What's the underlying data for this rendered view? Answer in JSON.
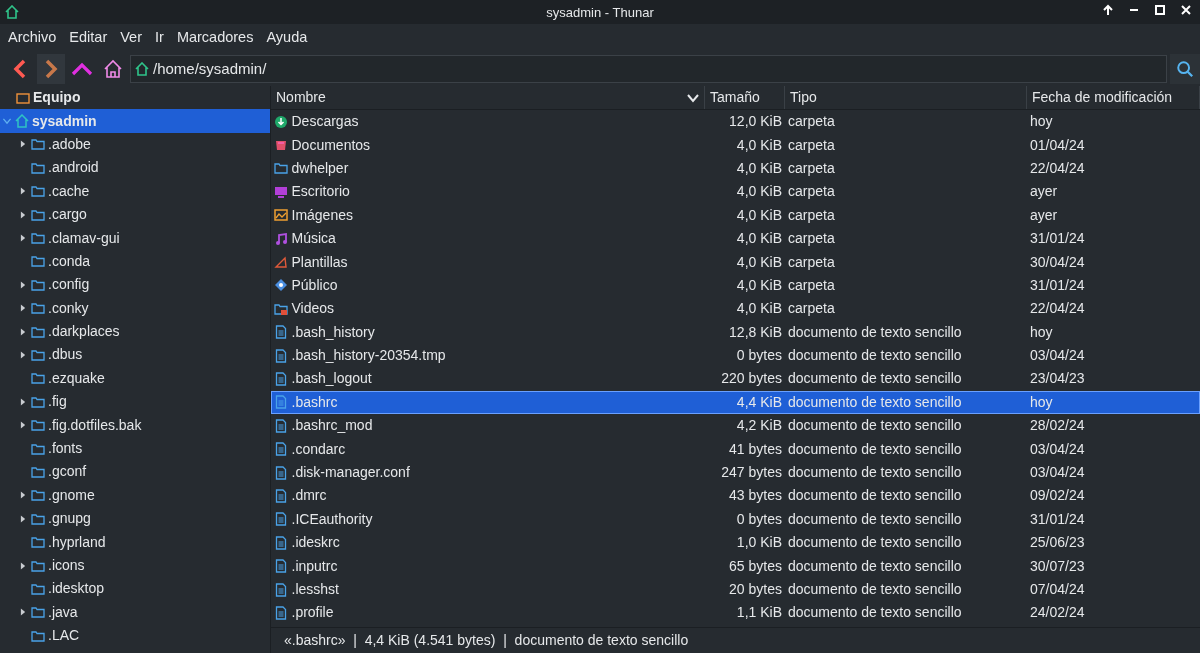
{
  "window": {
    "title": "sysadmin - Thunar"
  },
  "menu": [
    "Archivo",
    "Editar",
    "Ver",
    "Ir",
    "Marcadores",
    "Ayuda"
  ],
  "location": {
    "path": "/home/sysadmin/"
  },
  "sidebar": {
    "header": "Equipo",
    "tree": [
      {
        "label": "sysadmin",
        "selected": true,
        "expanded": true,
        "children": [
          {
            "label": ".adobe",
            "expandable": true
          },
          {
            "label": ".android",
            "expandable": false
          },
          {
            "label": ".cache",
            "expandable": true
          },
          {
            "label": ".cargo",
            "expandable": true
          },
          {
            "label": ".clamav-gui",
            "expandable": true
          },
          {
            "label": ".conda",
            "expandable": false
          },
          {
            "label": ".config",
            "expandable": true
          },
          {
            "label": ".conky",
            "expandable": true
          },
          {
            "label": ".darkplaces",
            "expandable": true
          },
          {
            "label": ".dbus",
            "expandable": true
          },
          {
            "label": ".ezquake",
            "expandable": false
          },
          {
            "label": ".fig",
            "expandable": true
          },
          {
            "label": ".fig.dotfiles.bak",
            "expandable": true
          },
          {
            "label": ".fonts",
            "expandable": false
          },
          {
            "label": ".gconf",
            "expandable": false
          },
          {
            "label": ".gnome",
            "expandable": true
          },
          {
            "label": ".gnupg",
            "expandable": true
          },
          {
            "label": ".hyprland",
            "expandable": false
          },
          {
            "label": ".icons",
            "expandable": true
          },
          {
            "label": ".idesktop",
            "expandable": false
          },
          {
            "label": ".java",
            "expandable": true
          },
          {
            "label": ".LAC",
            "expandable": false
          }
        ]
      }
    ]
  },
  "table": {
    "columns": [
      "Nombre",
      "Tamaño",
      "Tipo",
      "Fecha de modificación"
    ],
    "rows": [
      {
        "kind": "downloads",
        "name": "Descargas",
        "size": "12,0 KiB",
        "type": "carpeta",
        "date": "hoy",
        "selected": false
      },
      {
        "kind": "documents",
        "name": "Documentos",
        "size": "4,0 KiB",
        "type": "carpeta",
        "date": "01/04/24",
        "selected": false
      },
      {
        "kind": "folder",
        "name": "dwhelper",
        "size": "4,0 KiB",
        "type": "carpeta",
        "date": "22/04/24",
        "selected": false
      },
      {
        "kind": "desktop",
        "name": "Escritorio",
        "size": "4,0 KiB",
        "type": "carpeta",
        "date": "ayer",
        "selected": false
      },
      {
        "kind": "pictures",
        "name": "Imágenes",
        "size": "4,0 KiB",
        "type": "carpeta",
        "date": "ayer",
        "selected": false
      },
      {
        "kind": "music",
        "name": "Música",
        "size": "4,0 KiB",
        "type": "carpeta",
        "date": "31/01/24",
        "selected": false
      },
      {
        "kind": "templates",
        "name": "Plantillas",
        "size": "4,0 KiB",
        "type": "carpeta",
        "date": "30/04/24",
        "selected": false
      },
      {
        "kind": "public",
        "name": "Público",
        "size": "4,0 KiB",
        "type": "carpeta",
        "date": "31/01/24",
        "selected": false
      },
      {
        "kind": "videos",
        "name": "Videos",
        "size": "4,0 KiB",
        "type": "carpeta",
        "date": "22/04/24",
        "selected": false
      },
      {
        "kind": "text",
        "name": ".bash_history",
        "size": "12,8 KiB",
        "type": "documento de texto sencillo",
        "date": "hoy",
        "selected": false
      },
      {
        "kind": "text",
        "name": ".bash_history-20354.tmp",
        "size": "0 bytes",
        "type": "documento de texto sencillo",
        "date": "03/04/24",
        "selected": false
      },
      {
        "kind": "text",
        "name": ".bash_logout",
        "size": "220 bytes",
        "type": "documento de texto sencillo",
        "date": "23/04/23",
        "selected": false
      },
      {
        "kind": "text",
        "name": ".bashrc",
        "size": "4,4 KiB",
        "type": "documento de texto sencillo",
        "date": "hoy",
        "selected": true
      },
      {
        "kind": "text",
        "name": ".bashrc_mod",
        "size": "4,2 KiB",
        "type": "documento de texto sencillo",
        "date": "28/02/24",
        "selected": false
      },
      {
        "kind": "text",
        "name": ".condarc",
        "size": "41 bytes",
        "type": "documento de texto sencillo",
        "date": "03/04/24",
        "selected": false
      },
      {
        "kind": "text",
        "name": ".disk-manager.conf",
        "size": "247 bytes",
        "type": "documento de texto sencillo",
        "date": "03/04/24",
        "selected": false
      },
      {
        "kind": "text",
        "name": ".dmrc",
        "size": "43 bytes",
        "type": "documento de texto sencillo",
        "date": "09/02/24",
        "selected": false
      },
      {
        "kind": "text",
        "name": ".ICEauthority",
        "size": "0 bytes",
        "type": "documento de texto sencillo",
        "date": "31/01/24",
        "selected": false
      },
      {
        "kind": "text",
        "name": ".ideskrc",
        "size": "1,0 KiB",
        "type": "documento de texto sencillo",
        "date": "25/06/23",
        "selected": false
      },
      {
        "kind": "text",
        "name": ".inputrc",
        "size": "65 bytes",
        "type": "documento de texto sencillo",
        "date": "30/07/23",
        "selected": false
      },
      {
        "kind": "text",
        "name": ".lesshst",
        "size": "20 bytes",
        "type": "documento de texto sencillo",
        "date": "07/04/24",
        "selected": false
      },
      {
        "kind": "text",
        "name": ".profile",
        "size": "1,1 KiB",
        "type": "documento de texto sencillo",
        "date": "24/02/24",
        "selected": false
      }
    ]
  },
  "status_bar": "«.bashrc»  |  4,4 KiB (4.541 bytes)  |  documento de texto sencillo"
}
